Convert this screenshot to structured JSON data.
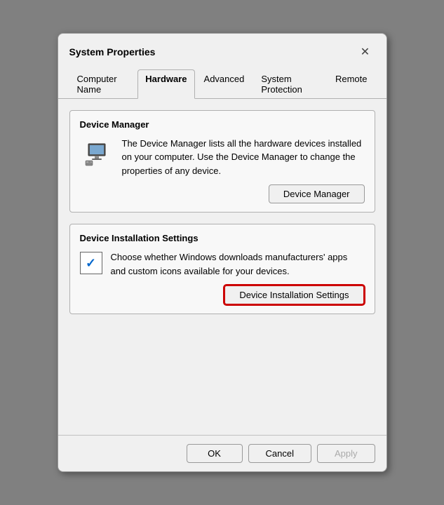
{
  "dialog": {
    "title": "System Properties",
    "close_label": "✕"
  },
  "tabs": [
    {
      "id": "computer-name",
      "label": "Computer Name",
      "active": false
    },
    {
      "id": "hardware",
      "label": "Hardware",
      "active": true
    },
    {
      "id": "advanced",
      "label": "Advanced",
      "active": false
    },
    {
      "id": "system-protection",
      "label": "System Protection",
      "active": false
    },
    {
      "id": "remote",
      "label": "Remote",
      "active": false
    }
  ],
  "device_manager_section": {
    "title": "Device Manager",
    "description": "The Device Manager lists all the hardware devices installed on your computer. Use the Device Manager to change the properties of any device.",
    "button_label": "Device Manager"
  },
  "device_installation_section": {
    "title": "Device Installation Settings",
    "description": "Choose whether Windows downloads manufacturers' apps and custom icons available for your devices.",
    "button_label": "Device Installation Settings"
  },
  "footer": {
    "ok_label": "OK",
    "cancel_label": "Cancel",
    "apply_label": "Apply"
  }
}
